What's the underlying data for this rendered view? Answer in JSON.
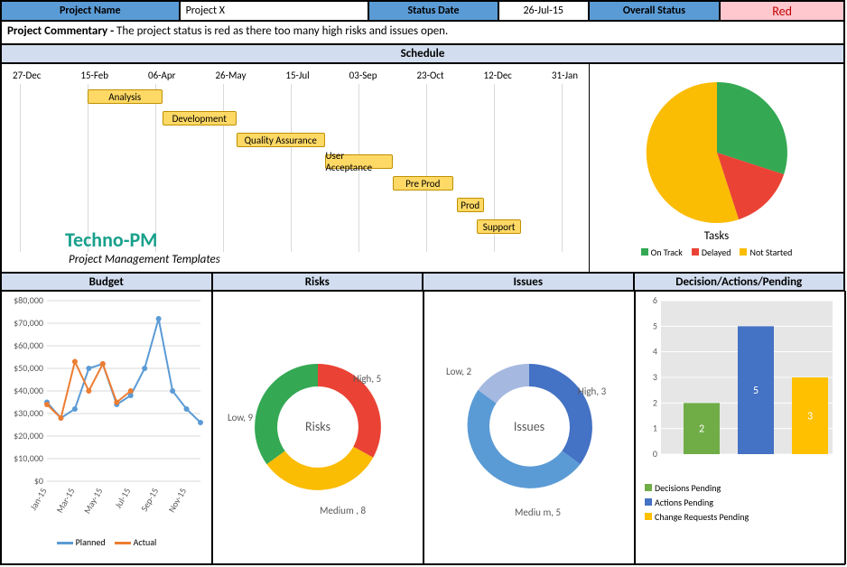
{
  "header": {
    "name_label": "Project Name",
    "name_value": "Project X",
    "date_label": "Status Date",
    "date_value": "26-Jul-15",
    "status_label": "Overall Status",
    "status_value": "Red"
  },
  "commentary": {
    "label": "Project Commentary - ",
    "text": "The project status is red as there too many high risks and issues open."
  },
  "schedule": {
    "title": "Schedule",
    "ticks": [
      "27-Dec",
      "15-Feb",
      "06-Apr",
      "26-May",
      "15-Jul",
      "03-Sep",
      "23-Oct",
      "12-Dec",
      "31-Jan"
    ],
    "bars": [
      {
        "label": "Analysis",
        "start": 1,
        "end": 2.1,
        "row": 0
      },
      {
        "label": "Development",
        "start": 2.1,
        "end": 3.2,
        "row": 1
      },
      {
        "label": "Quality Assurance",
        "start": 3.2,
        "end": 4.5,
        "row": 2
      },
      {
        "label": "User Acceptance",
        "start": 4.5,
        "end": 5.5,
        "row": 3
      },
      {
        "label": "Pre Prod",
        "start": 5.5,
        "end": 6.4,
        "row": 4
      },
      {
        "label": "Prod",
        "start": 6.45,
        "end": 6.85,
        "row": 5
      },
      {
        "label": "Support",
        "start": 6.75,
        "end": 7.4,
        "row": 6
      }
    ],
    "brand": "Techno-PM",
    "brand_sub": "Project Management Templates"
  },
  "tasks": {
    "title": "Tasks",
    "legend": [
      {
        "label": "On Track",
        "color": "#34a853"
      },
      {
        "label": "Delayed",
        "color": "#ea4335"
      },
      {
        "label": "Not Started",
        "color": "#fbbc04"
      }
    ]
  },
  "subheaders": [
    "Budget",
    "Risks",
    "Issues",
    "Decision/Actions/Pending"
  ],
  "risks": {
    "center": "Risks",
    "items": [
      {
        "label": "High, 5",
        "color": "#ea4335"
      },
      {
        "label": "Medium , 8",
        "color": "#fbbc04"
      },
      {
        "label": "Low, 9",
        "color": "#34a853"
      }
    ]
  },
  "issues": {
    "center": "Issues",
    "items": [
      {
        "label": "High, 3",
        "color": "#4472c4"
      },
      {
        "label": "Mediu m, 5",
        "color": "#5b9bd5"
      },
      {
        "label": "Low, 2",
        "color": "#a5b8e0"
      }
    ]
  },
  "budget": {
    "ylabels": [
      "$0",
      "$10,000",
      "$20,000",
      "$30,000",
      "$40,000",
      "$50,000",
      "$60,000",
      "$70,000",
      "$80,000"
    ],
    "xlabels": [
      "Jan-15",
      "Mar-15",
      "May-15",
      "Jul-15",
      "Sep-15",
      "Nov-15"
    ],
    "legend": [
      {
        "label": "Planned",
        "color": "#5b9bd5"
      },
      {
        "label": "Actual",
        "color": "#ed7d31"
      }
    ]
  },
  "dap": {
    "ylabels": [
      "0",
      "1",
      "2",
      "3",
      "4",
      "5",
      "6"
    ],
    "bars": [
      {
        "label": "2",
        "value": 2,
        "color": "#70ad47"
      },
      {
        "label": "5",
        "value": 5,
        "color": "#4472c4"
      },
      {
        "label": "3",
        "value": 3,
        "color": "#ffc000"
      }
    ],
    "legend": [
      {
        "label": "Decisions Pending",
        "color": "#70ad47"
      },
      {
        "label": "Actions Pending",
        "color": "#4472c4"
      },
      {
        "label": "Change Requests Pending",
        "color": "#ffc000"
      }
    ]
  },
  "chart_data": [
    {
      "type": "gantt",
      "title": "Schedule",
      "x_ticks": [
        "27-Dec",
        "15-Feb",
        "06-Apr",
        "26-May",
        "15-Jul",
        "03-Sep",
        "23-Oct",
        "12-Dec",
        "31-Jan"
      ],
      "tasks": [
        {
          "name": "Analysis",
          "start": "15-Feb",
          "end": "06-Apr"
        },
        {
          "name": "Development",
          "start": "06-Apr",
          "end": "26-May"
        },
        {
          "name": "Quality Assurance",
          "start": "26-May",
          "end": "20-Jul"
        },
        {
          "name": "User Acceptance",
          "start": "20-Jul",
          "end": "03-Sep"
        },
        {
          "name": "Pre Prod",
          "start": "03-Sep",
          "end": "15-Oct"
        },
        {
          "name": "Prod",
          "start": "23-Oct",
          "end": "05-Nov"
        },
        {
          "name": "Support",
          "start": "05-Nov",
          "end": "31-Jan"
        }
      ]
    },
    {
      "type": "pie",
      "title": "Tasks",
      "series": [
        {
          "name": "Tasks",
          "values": [
            {
              "label": "On Track",
              "value": 25
            },
            {
              "label": "Delayed",
              "value": 15
            },
            {
              "label": "Not Started",
              "value": 60
            }
          ]
        }
      ]
    },
    {
      "type": "line",
      "title": "Budget",
      "x": [
        "Jan-15",
        "Feb-15",
        "Mar-15",
        "Apr-15",
        "May-15",
        "Jun-15",
        "Jul-15",
        "Aug-15",
        "Sep-15",
        "Oct-15",
        "Nov-15",
        "Dec-15"
      ],
      "ylim": [
        0,
        80000
      ],
      "series": [
        {
          "name": "Planned",
          "values": [
            35000,
            28000,
            32000,
            50000,
            52000,
            34000,
            38000,
            50000,
            72000,
            40000,
            32000,
            26000
          ]
        },
        {
          "name": "Actual",
          "values": [
            34000,
            28000,
            53000,
            40000,
            52000,
            35000,
            40000
          ]
        }
      ]
    },
    {
      "type": "pie",
      "title": "Risks",
      "series": [
        {
          "name": "Risks",
          "values": [
            {
              "label": "High",
              "value": 5
            },
            {
              "label": "Medium",
              "value": 8
            },
            {
              "label": "Low",
              "value": 9
            }
          ]
        }
      ]
    },
    {
      "type": "pie",
      "title": "Issues",
      "series": [
        {
          "name": "Issues",
          "values": [
            {
              "label": "High",
              "value": 3
            },
            {
              "label": "Medium",
              "value": 5
            },
            {
              "label": "Low",
              "value": 2
            }
          ]
        }
      ]
    },
    {
      "type": "bar",
      "title": "Decision/Actions/Pending",
      "categories": [
        "Decisions Pending",
        "Actions Pending",
        "Change Requests Pending"
      ],
      "values": [
        2,
        5,
        3
      ],
      "ylim": [
        0,
        6
      ]
    }
  ]
}
